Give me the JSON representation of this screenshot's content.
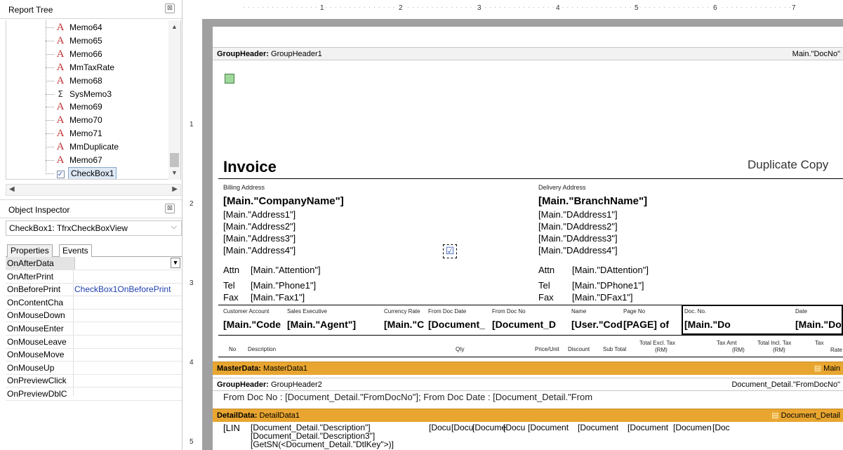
{
  "report_tree": {
    "title": "Report Tree",
    "items": [
      {
        "label": "Memo64",
        "type": "memo"
      },
      {
        "label": "Memo65",
        "type": "memo"
      },
      {
        "label": "Memo66",
        "type": "memo"
      },
      {
        "label": "MmTaxRate",
        "type": "memo"
      },
      {
        "label": "Memo68",
        "type": "memo"
      },
      {
        "label": "SysMemo3",
        "type": "sysmemo"
      },
      {
        "label": "Memo69",
        "type": "memo"
      },
      {
        "label": "Memo70",
        "type": "memo"
      },
      {
        "label": "Memo71",
        "type": "memo"
      },
      {
        "label": "MmDuplicate",
        "type": "memo"
      },
      {
        "label": "Memo67",
        "type": "memo"
      },
      {
        "label": "CheckBox1",
        "type": "checkbox",
        "selected": true
      }
    ]
  },
  "object_inspector": {
    "title": "Object Inspector",
    "object": "CheckBox1: TfrxCheckBoxView",
    "tabs": [
      "Properties",
      "Events"
    ],
    "active_tab": "Events",
    "rows": [
      {
        "name": "OnAfterData",
        "value": ""
      },
      {
        "name": "OnAfterPrint",
        "value": ""
      },
      {
        "name": "OnBeforePrint",
        "value": "CheckBox1OnBeforePrint"
      },
      {
        "name": "OnContentCha",
        "value": ""
      },
      {
        "name": "OnMouseDown",
        "value": ""
      },
      {
        "name": "OnMouseEnter",
        "value": ""
      },
      {
        "name": "OnMouseLeave",
        "value": ""
      },
      {
        "name": "OnMouseMove",
        "value": ""
      },
      {
        "name": "OnMouseUp",
        "value": ""
      },
      {
        "name": "OnPreviewClick",
        "value": ""
      },
      {
        "name": "OnPreviewDblC",
        "value": ""
      }
    ]
  },
  "ruler": {
    "h": [
      "1",
      "2",
      "3",
      "4",
      "5",
      "6",
      "7"
    ],
    "v": [
      "1",
      "2",
      "3",
      "4",
      "5"
    ]
  },
  "report": {
    "gh1_label": "GroupHeader:",
    "gh1_name": "GroupHeader1",
    "gh1_cond": "Main.\"DocNo\"",
    "invoice": "Invoice",
    "duplicate": "Duplicate Copy",
    "billing": "Billing Address",
    "delivery": "Delivery Address",
    "company": "[Main.\"CompanyName\"]",
    "branch": "[Main.\"BranchName\"]",
    "addr": [
      "[Main.\"Address1\"]",
      "[Main.\"Address2\"]",
      "[Main.\"Address3\"]",
      "[Main.\"Address4\"]"
    ],
    "daddr": [
      "[Main.\"DAddress1\"]",
      "[Main.\"DAddress2\"]",
      "[Main.\"DAddress3\"]",
      "[Main.\"DAddress4\"]"
    ],
    "attn": "Attn",
    "attn_v": "[Main.\"Attention\"]",
    "dattn_v": "[Main.\"DAttention\"]",
    "tel": "Tel",
    "tel_v": "[Main.\"Phone1\"]",
    "dtel_v": "[Main.\"DPhone1\"]",
    "fax": "Fax",
    "fax_v": "[Main.\"Fax1\"]",
    "dfax_v": "[Main.\"DFax1\"]",
    "hdr_labels": [
      "Customer Account",
      "Sales Executive",
      "Currency Rate",
      "From Doc Date",
      "From Doc No",
      "Name",
      "Page No",
      "Doc. No.",
      "Date"
    ],
    "hdr_values": [
      "[Main.\"Code",
      "[Main.\"Agent\"]",
      "[Main.\"C",
      "[Document_",
      "[Document_D",
      "[User.\"Cod",
      "[PAGE] of",
      "[Main.\"Do",
      "[Main.\"DocD"
    ],
    "col_no": "No",
    "col_desc": "Description",
    "col_qty": "Qty",
    "col_price": "Price/Unit",
    "col_disc": "Discount",
    "col_sub": "Sub Total",
    "col_excl": [
      "Total Excl. Tax",
      "(RM)"
    ],
    "col_taxamt": [
      "Tax Amt",
      "(RM)"
    ],
    "col_incl": [
      "Total Incl. Tax",
      "(RM)"
    ],
    "col_rate": [
      "Tax",
      "Rate"
    ],
    "md_label": "MasterData:",
    "md_name": "MasterData1",
    "md_right": "Main",
    "gh2_label": "GroupHeader:",
    "gh2_name": "GroupHeader2",
    "gh2_cond": "Document_Detail.\"FromDocNo\"",
    "gh2_text": "From Doc No : [Document_Detail.\"FromDocNo\"];    From Doc Date : [Document_Detail.\"From",
    "dd_label": "DetailData:",
    "dd_name": "DetailData1",
    "dd_right": "Document_Detail",
    "dd_line": "[LIN",
    "dd_desc": [
      "[Document_Detail.\"Description\"]",
      "[Document_Detail.\"Description3\"]",
      "[GetSN(<Document_Detail.\"DtlKey\">)]"
    ],
    "dd_cells": [
      "[Docu",
      "[Docu",
      "[Docume",
      "[Docu",
      "[Document",
      "[Document",
      "[Document",
      "[Documen",
      "[Doc"
    ]
  }
}
